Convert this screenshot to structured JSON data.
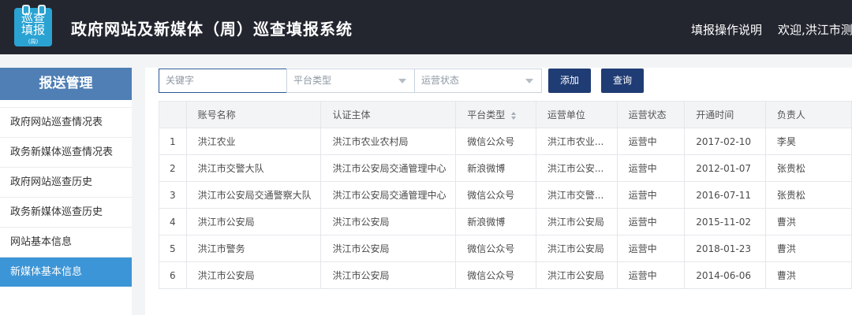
{
  "header": {
    "logo_text": "巡查填报",
    "logo_sub": "(周)",
    "title": "政府网站及新媒体（周）巡查填报系统",
    "help_link": "填报操作说明",
    "welcome": "欢迎,洪江市测"
  },
  "sidebar": {
    "title": "报送管理",
    "items": [
      {
        "label": "政府网站巡查情况表"
      },
      {
        "label": "政务新媒体巡查情况表"
      },
      {
        "label": "政府网站巡查历史"
      },
      {
        "label": "政务新媒体巡查历史"
      },
      {
        "label": "网站基本信息"
      },
      {
        "label": "新媒体基本信息",
        "active": true
      }
    ]
  },
  "filters": {
    "keyword_placeholder": "关键字",
    "platform_type": "平台类型",
    "operation_status": "运营状态",
    "add_label": "添加",
    "query_label": "查询"
  },
  "table": {
    "columns": [
      "",
      "账号名称",
      "认证主体",
      "平台类型",
      "运营单位",
      "运营状态",
      "开通时间",
      "负责人"
    ],
    "rows": [
      [
        "1",
        "洪江农业",
        "洪江市农业农村局",
        "微信公众号",
        "洪江市农业...",
        "运营中",
        "2017-02-10",
        "李昊"
      ],
      [
        "2",
        "洪江市交警大队",
        "洪江市公安局交通管理中心",
        "新浪微博",
        "洪江市公安...",
        "运营中",
        "2012-01-07",
        "张贵松"
      ],
      [
        "3",
        "洪江市公安局交通警察大队",
        "洪江市公安局交通管理中心",
        "微信公众号",
        "洪江市交警...",
        "运营中",
        "2016-07-11",
        "张贵松"
      ],
      [
        "4",
        "洪江市公安局",
        "洪江市公安局",
        "新浪微博",
        "洪江市公安局",
        "运营中",
        "2015-11-02",
        "曹洪"
      ],
      [
        "5",
        "洪江市警务",
        "洪江市公安局",
        "微信公众号",
        "洪江市公安局",
        "运营中",
        "2018-01-23",
        "曹洪"
      ],
      [
        "6",
        "洪江市公安局",
        "洪江市公安局",
        "微信公众号",
        "洪江市公安局",
        "运营中",
        "2014-06-06",
        "曹洪"
      ]
    ]
  },
  "colors": {
    "header_bg": "#23262f",
    "sidebar_head": "#4f7fb4",
    "sidebar_active": "#3c95d6",
    "button": "#203c74",
    "logo": "#2aa3d3"
  }
}
